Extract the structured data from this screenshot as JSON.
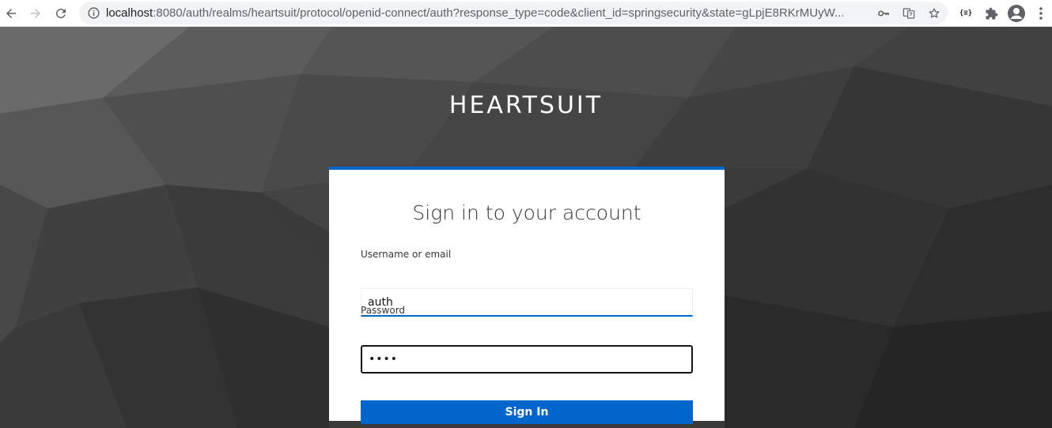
{
  "browser": {
    "url_host": "localhost",
    "url_rest": ":8080/auth/realms/heartsuit/protocol/openid-connect/auth?response_type=code&client_id=springsecurity&state=gLpjE8RKrMUyW...",
    "ext_badge": "{≡}"
  },
  "page": {
    "brand": "HEARTSUIT",
    "card": {
      "title": "Sign in to your account",
      "username_label": "Username or email",
      "username_value": "auth",
      "password_label": "Password",
      "password_value": "••••",
      "signin_label": "Sign In"
    }
  },
  "colors": {
    "accent": "#0066cc",
    "background": "#2e2e2e"
  }
}
